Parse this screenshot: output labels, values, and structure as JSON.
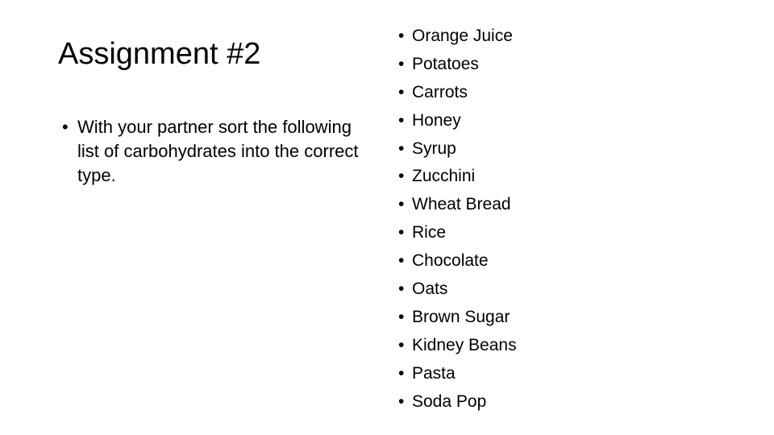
{
  "slide": {
    "title": "Assignment #2",
    "bullet_glyph": "•",
    "instructions": [
      "With your partner sort the following list of carbohydrates into the correct type."
    ],
    "items": [
      "Orange Juice",
      "Potatoes",
      "Carrots",
      "Honey",
      "Syrup",
      "Zucchini",
      "Wheat Bread",
      "Rice",
      "Chocolate",
      "Oats",
      "Brown Sugar",
      "Kidney Beans",
      "Pasta",
      "Soda Pop"
    ],
    "colors": {
      "background": "#ffffff",
      "text": "#000000"
    }
  }
}
